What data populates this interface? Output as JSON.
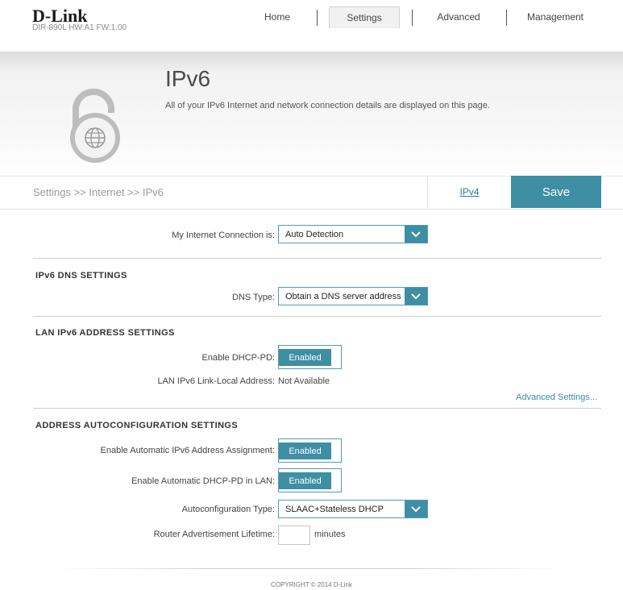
{
  "header": {
    "logo": "D-Link",
    "model_info": "DIR-890L   HW:A1   FW:1.00",
    "nav": [
      "Home",
      "Settings",
      "Advanced",
      "Management"
    ],
    "active_nav": "Settings"
  },
  "banner": {
    "title": "IPv6",
    "description": "All of your IPv6 Internet and network connection details are displayed on this page.",
    "icon": "lock-globe-icon"
  },
  "toolbar": {
    "breadcrumb": "Settings >> Internet >> IPv6",
    "ipv4_link": "IPv4",
    "save_label": "Save"
  },
  "connection": {
    "label": "My Internet Connection is:",
    "value": "Auto Detection"
  },
  "dns": {
    "title": "IPv6 DNS SETTINGS",
    "type_label": "DNS Type:",
    "type_value": "Obtain a DNS server address"
  },
  "lan": {
    "title": "LAN IPv6 ADDRESS SETTINGS",
    "dhcp_pd_label": "Enable DHCP-PD:",
    "dhcp_pd_value": "Enabled",
    "link_local_label": "LAN IPv6 Link-Local Address:",
    "link_local_value": "Not Available",
    "advanced_link": "Advanced Settings..."
  },
  "autoconf": {
    "title": "ADDRESS AUTOCONFIGURATION SETTINGS",
    "auto_assign_label": "Enable Automatic IPv6 Address Assignment:",
    "auto_assign_value": "Enabled",
    "auto_dhcp_pd_label": "Enable Automatic DHCP-PD in LAN:",
    "auto_dhcp_pd_value": "Enabled",
    "type_label": "Autoconfiguration Type:",
    "type_value": "SLAAC+Stateless DHCP",
    "lifetime_label": "Router Advertisement Lifetime:",
    "lifetime_value": "",
    "lifetime_unit": "minutes"
  },
  "footer": {
    "copyright": "COPYRIGHT © 2014 D-Link"
  },
  "colors": {
    "accent": "#3e8ea4",
    "link": "#2a7d96"
  }
}
